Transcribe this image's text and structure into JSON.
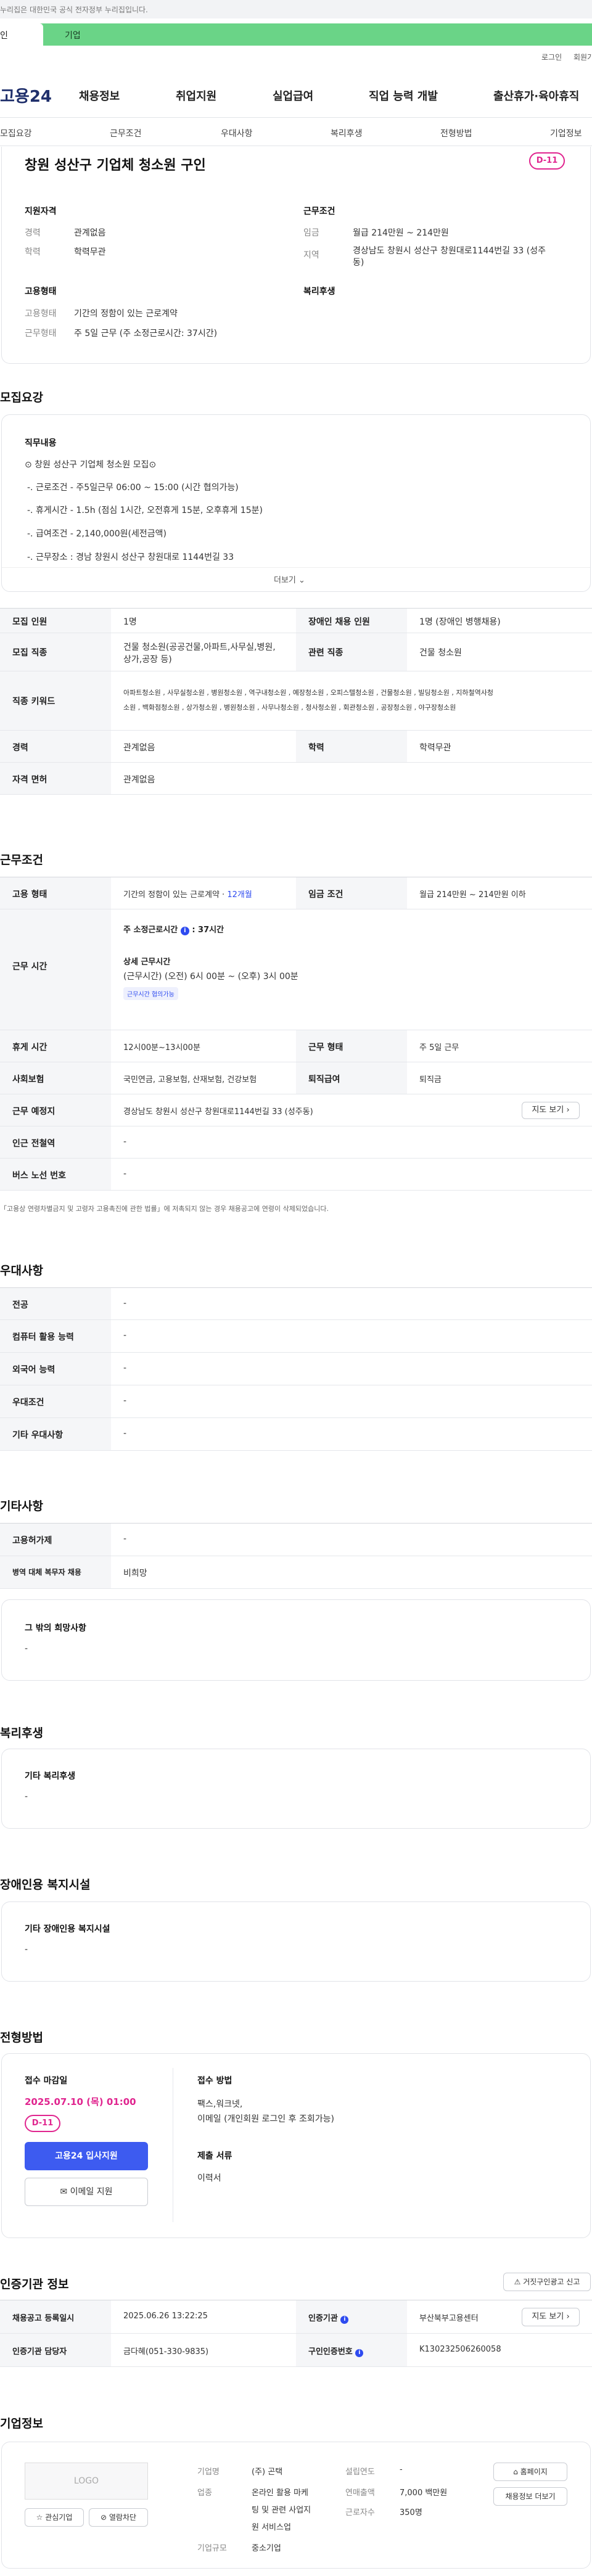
{
  "banner": {
    "text": "누리집은 대한민국 공식 전자정부 누리집입니다."
  },
  "tabs": {
    "individual": "인",
    "business": "기업"
  },
  "util": {
    "login": "로그인",
    "signup": "회원가"
  },
  "header": {
    "logo": "고용24",
    "nav": [
      "채용정보",
      "취업지원",
      "실업급여",
      "직업 능력 개발",
      "출산휴가·육아휴직"
    ]
  },
  "subnav": [
    "모집요강",
    "근무조건",
    "우대사항",
    "복리후생",
    "전형방법",
    "기업정보"
  ],
  "job": {
    "title": "창원 성산구 기업체 청소원 구인",
    "dday": "D-11",
    "qual_head": "지원자격",
    "career_k": "경력",
    "career_v": "관계없음",
    "edu_k": "학력",
    "edu_v": "학력무관",
    "work_head": "근무조건",
    "wage_k": "임금",
    "wage_v": "월급 214만원 ~ 214만원",
    "loc_k": "지역",
    "loc_v1": "경상남도 창원시 성산구 창원대로1144번길 33 (성주",
    "loc_v2": "동)",
    "emp_head": "고용형태",
    "emptype_k": "고용형태",
    "emptype_v": "기간의 정함이 있는 근로계약",
    "worktype_k": "근무형태",
    "worktype_v": "주 5일 근무 (주 소정근로시간: 37시간)",
    "welfare_head": "복리후생"
  },
  "recruit": {
    "title": "모집요강",
    "duty_head": "직무내용",
    "lines": [
      "⊙ 창원 성산구 기업체 청소원 모집⊙",
      "-. 근로조건 - 주5일근무 06:00 ~ 15:00 (시간 협의가능)",
      "-. 휴게시간 - 1.5h (점심 1시간, 오전휴게 15분, 오후휴게 15분)",
      "-. 급여조건 - 2,140,000원(세전금액)",
      "-. 근무장소 : 경남 창원시 성산구 창원대로 1144번길 33"
    ],
    "more": "더보기",
    "table": {
      "people_k": "모집 인원",
      "people_v": "1명",
      "disabled_k": "장애인 채용 인원",
      "disabled_v": "1명 (장애인 병행채용)",
      "job_k": "모집 직종",
      "job_v1": "건물 청소원(공공건물,아파트,사무실,병원,",
      "job_v2": "상가,공장 등)",
      "rel_k": "관련 직종",
      "rel_v": "건물 청소원",
      "kw_k": "직종 키워드",
      "kw_v1": "아파트청소원 , 사무실청소원 , 병원청소원 , 역구내청소원 , 예장청소원 , 오피스텔청소원 , 건물청소원 , 빌딩청소원 , 지하철역사청",
      "kw_v2": "소원 , 백화점청소원 , 상가청소원 , 병원청소원 , 사무나청소원 , 청사청소원 , 회관청소원 , 공장청소원 , 야구장청소원",
      "career_k": "경력",
      "career_v": "관계없음",
      "edu_k": "학력",
      "edu_v": "학력무관",
      "license_k": "자격 면허",
      "license_v": "관계없음"
    }
  },
  "cond": {
    "title": "근무조건",
    "emp_k": "고용 형태",
    "emp_v": "기간의 정함이 있는 근로계약 ·",
    "emp_months": "12개월",
    "wage_k": "임금 조건",
    "wage_v": "월급 214만원 ~ 214만원 이하",
    "hours_k": "근무 시간",
    "hours_week": "주 소정근로시간",
    "hours_week_v": ": 37시간",
    "hours_detail_h": "상세 근무시간",
    "hours_detail_v": "(근무시간) (오전) 6시 00분 ~ (오후) 3시 00분",
    "hours_badge": "근무시간 협의가능",
    "break_k": "휴게 시간",
    "break_v": "12시00분~13시00분",
    "form_k": "근무 형태",
    "form_v": "주 5일 근무",
    "ins_k": "사회보험",
    "ins_v": "국민연금, 고용보험, 산재보험, 건강보험",
    "sev_k": "퇴직급여",
    "sev_v": "퇴직금",
    "place_k": "근무 예정지",
    "place_v": "경상남도 창원시 성산구 창원대로1144번길 33 (성주동)",
    "map_btn": "지도 보기",
    "subway_k": "인근 전철역",
    "subway_v": "-",
    "bus_k": "버스 노선 번호",
    "bus_v": "-",
    "note": "「고용상 연령차별금지 및 고령자 고용촉진에 관한 법률」에 저촉되지 않는 경우 채용공고에 연령이 삭제되었습니다."
  },
  "pref": {
    "title": "우대사항",
    "rows": [
      {
        "k": "전공",
        "v": "-"
      },
      {
        "k": "컴퓨터 활용 능력",
        "v": "-"
      },
      {
        "k": "외국어 능력",
        "v": "-"
      },
      {
        "k": "우대조건",
        "v": "-"
      },
      {
        "k": "기타 우대사항",
        "v": "-"
      }
    ]
  },
  "etc": {
    "title": "기타사항",
    "rows": [
      {
        "k": "고용허가제",
        "v": "-"
      },
      {
        "k": "병역 대체 복무자 채용",
        "v": "비희망"
      }
    ],
    "wish_h": "그 밖의 희망사항",
    "wish_v": "-"
  },
  "welfare": {
    "title": "복리후생",
    "sub": "기타 복리후생",
    "v": "-"
  },
  "dis": {
    "title": "장애인용 복지시설",
    "sub": "기타 장애인용 복지시설",
    "v": "-"
  },
  "sel": {
    "title": "전형방법",
    "deadline_h": "접수 마감일",
    "deadline_v": "2025.07.10 (목) 01:00",
    "dday": "D-11",
    "apply_btn": "고용24 입사지원",
    "email_btn": "이메일 지원",
    "method_h": "접수 방법",
    "method_v1": "팩스,워크넷,",
    "method_v2": "이메일 (개인회원 로그인 후 조회가능)",
    "docs_h": "제출 서류",
    "docs_v": "이력서"
  },
  "cert": {
    "title": "인증기관 정보",
    "report_btn": "거짓구인광고 신고",
    "reg_k": "채용공고 등록일시",
    "reg_v": "2025.06.26 13:22:25",
    "org_k": "인증기관",
    "org_v": "부산북부고용센터",
    "map_btn": "지도 보기",
    "mgr_k": "인증기관 담당자",
    "mgr_v": "금다혜(051-330-9835)",
    "id_k": "구인인증번호",
    "id_v": "K130232506260058"
  },
  "company": {
    "title": "기업정보",
    "logo": "LOGO",
    "fav_btn": "관심기업",
    "block_btn": "열람차단",
    "name_k": "기업명",
    "name_v": "(주) 곤택",
    "ind_k": "업종",
    "ind_v": [
      "온라인 활용 마케",
      "팅 및 관련 사업지",
      "원 서비스업"
    ],
    "size_k": "기업규모",
    "size_v": "중소기업",
    "year_k": "설립연도",
    "year_v": "-",
    "sales_k": "연매출액",
    "sales_v": "7,000 백만원",
    "emp_k": "근로자수",
    "emp_v": "350명",
    "home_btn": "홈페이지",
    "jobs_btn": "채용정보 더보기"
  },
  "colors": {
    "green": "#6ad487",
    "pink": "#e0258f",
    "blue": "#2e4bf0",
    "navy": "#1f2f6b"
  }
}
